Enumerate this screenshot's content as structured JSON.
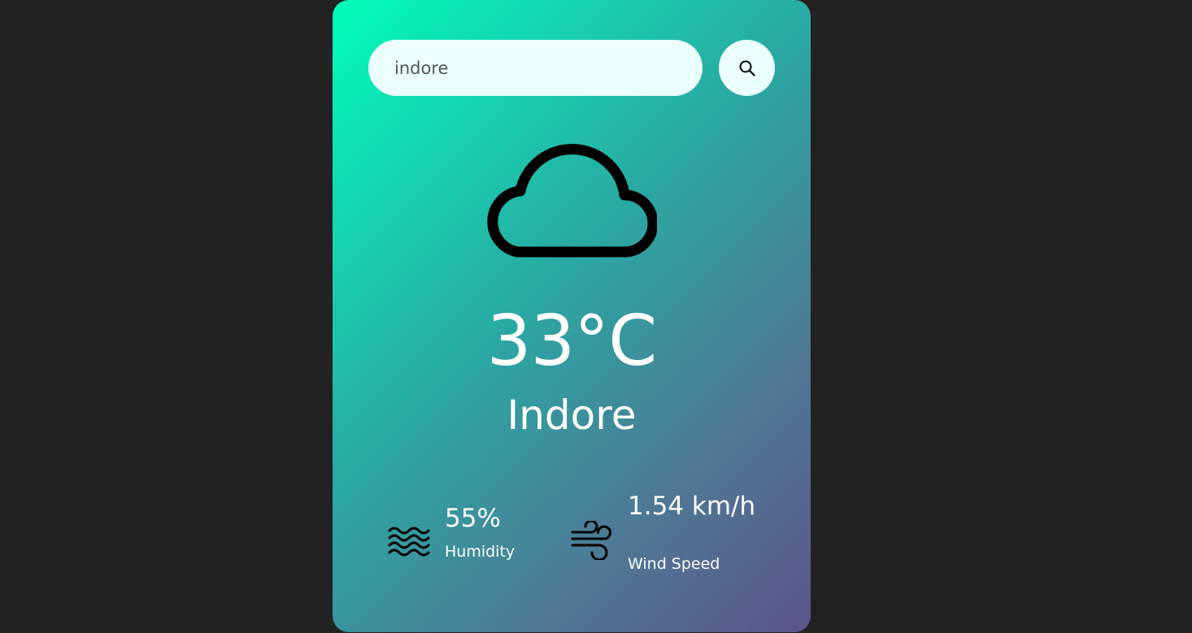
{
  "search": {
    "value": "indore",
    "icon": "search-icon"
  },
  "weather": {
    "icon": "cloud-icon",
    "temperature": "33°C",
    "city": "Indore"
  },
  "details": {
    "humidity": {
      "icon": "humidity-icon",
      "value": "55%",
      "label": "Humidity"
    },
    "wind": {
      "icon": "wind-icon",
      "value": "1.54 km/h",
      "label": "Wind Speed"
    }
  },
  "colors": {
    "page_background": "#222222",
    "gradient_start": "#00feba",
    "gradient_end": "#5b548a",
    "input_background": "#ebfffc",
    "text": "#ffffff"
  }
}
